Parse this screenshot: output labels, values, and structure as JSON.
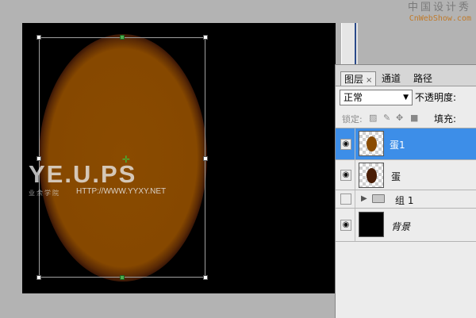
{
  "watermark": {
    "text_cn": "中国设计秀",
    "text_url": "CnWebShow.com"
  },
  "canvas_watermark": {
    "main": "YE.U.PS",
    "sub_cn": "业余学院",
    "site": "HTTP://WWW.YYXY.NET"
  },
  "canvas": {
    "background": "#000000",
    "egg_fill": "#8a4b00",
    "egg_edge": "#3a1606"
  },
  "layers_panel": {
    "tabs": [
      {
        "label": "图层",
        "close": "×",
        "active": true
      },
      {
        "label": "通道",
        "active": false
      },
      {
        "label": "路径",
        "active": false
      }
    ],
    "blend_mode": "正常",
    "opacity_label": "不透明度:",
    "lock_label": "锁定:",
    "fill_label": "填充:",
    "layers": [
      {
        "name": "蛋1",
        "visible": true,
        "selected": true,
        "thumb": "egg-brown"
      },
      {
        "name": "蛋",
        "visible": true,
        "selected": false,
        "thumb": "egg-dark"
      },
      {
        "name": "组 1",
        "visible": false,
        "selected": false,
        "type": "group"
      },
      {
        "name": "背景",
        "visible": true,
        "selected": false,
        "thumb": "black"
      }
    ],
    "selected_color": "#3d8ee8"
  }
}
